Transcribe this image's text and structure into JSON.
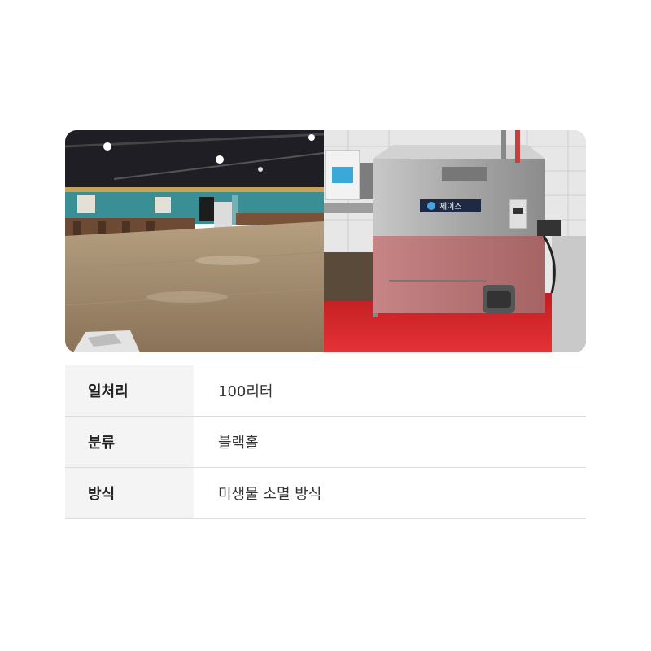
{
  "machine_brand_text": "제이스",
  "specs": [
    {
      "label": "일처리",
      "value": "100리터"
    },
    {
      "label": "분류",
      "value": "블랙홀"
    },
    {
      "label": "방식",
      "value": "미생물 소멸 방식"
    }
  ],
  "colors": {
    "floor_red": "#d8262a",
    "steel": "#b7b7b7",
    "wood_floor": "#9a8468",
    "table_header_bg": "#f4f4f4",
    "divider": "#dcdcdc"
  }
}
